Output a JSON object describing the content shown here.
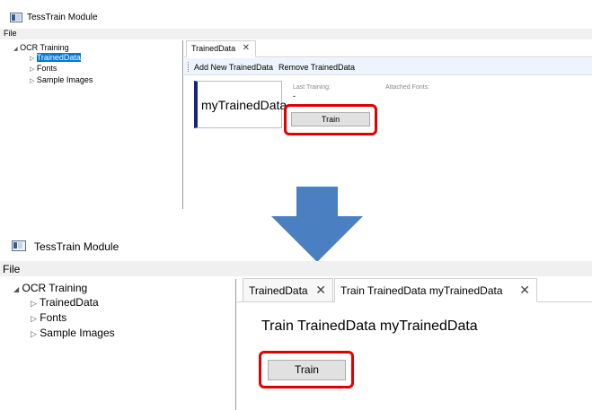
{
  "app": {
    "title": "TessTrain Module"
  },
  "menu": {
    "file": "File"
  },
  "tree": {
    "root": "OCR Training",
    "root_caret": "◢",
    "child_caret": "▷",
    "items": [
      "TrainedData",
      "Fonts",
      "Sample Images"
    ]
  },
  "before": {
    "tab": {
      "label": "TrainedData",
      "close": "✕"
    },
    "toolbar": {
      "add": "Add New TrainedData",
      "remove": "Remove TrainedData"
    },
    "card": {
      "name": "myTrainedData"
    },
    "last_training_label": "Last Training:",
    "last_training_value": "-",
    "attached_fonts_label": "Attached Fonts:",
    "train_button": "Train"
  },
  "after": {
    "tabs": [
      {
        "label": "TrainedData",
        "close": "✕"
      },
      {
        "label": "Train TrainedData  myTrainedData",
        "close": "✕"
      }
    ],
    "heading": "Train TrainedData  myTrainedData",
    "train_button": "Train"
  },
  "colors": {
    "highlight": "#e00000",
    "selection": "#0078d7",
    "arrow": "#4a7fc1",
    "card_accent": "#1a237e"
  },
  "icons": {
    "window": "window-icon",
    "arrow": "down-arrow-icon",
    "close": "close-icon",
    "expand": "expand-caret-icon"
  }
}
